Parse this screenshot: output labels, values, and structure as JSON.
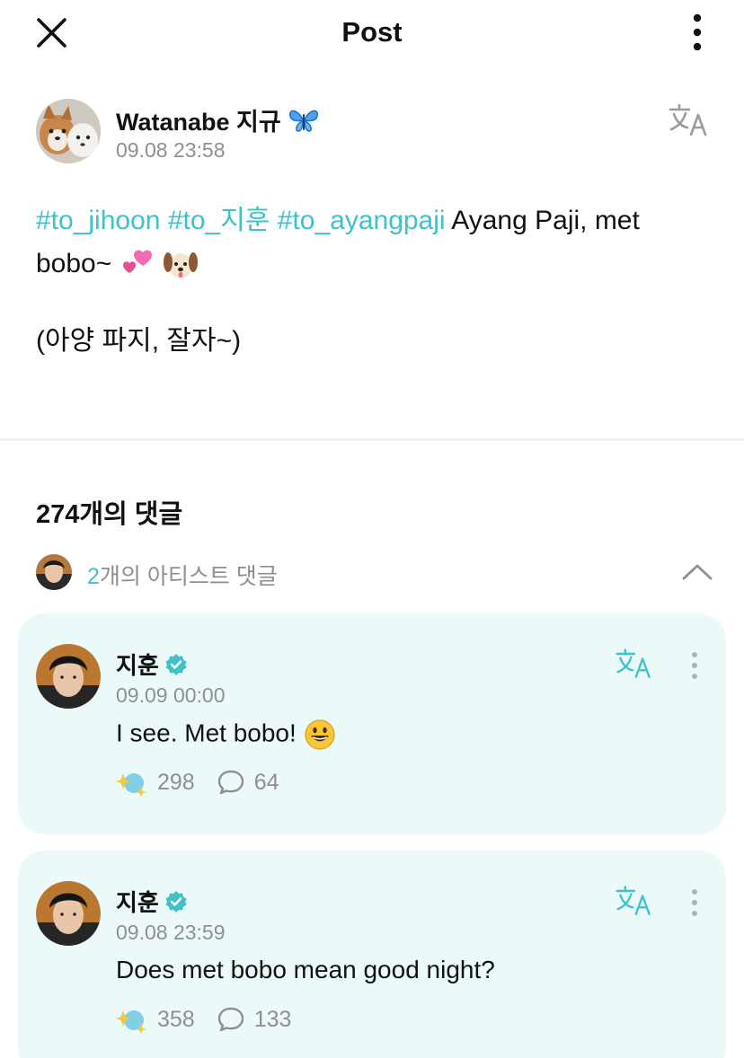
{
  "header": {
    "title": "Post"
  },
  "post": {
    "author_name": "Watanabe 지규",
    "time": "09.08 23:58",
    "hashtags": [
      "#to_jihoon",
      "#to_지훈",
      "#to_ayangpaji"
    ],
    "text_line1": "Ayang Paji, met",
    "text_line2": "bobo~",
    "translation": "(아양 파지, 잘자~)"
  },
  "comments": {
    "count_label": "274개의 댓글",
    "artist_count": "2",
    "artist_label": "개의 아티스트 댓글",
    "items": [
      {
        "author": "지훈",
        "time": "09.09 00:00",
        "text": "I see. Met bobo!",
        "likes": "298",
        "replies": "64"
      },
      {
        "author": "지훈",
        "time": "09.08 23:59",
        "text": "Does met bobo mean good night?",
        "likes": "358",
        "replies": "133"
      }
    ]
  },
  "colors": {
    "accent": "#3fc1c9",
    "card_bg": "#ebfaf8",
    "muted": "#8e8e93"
  },
  "icons": [
    "close-icon",
    "more-vertical-icon",
    "translate-icon",
    "verified-badge-icon",
    "chevron-up-icon",
    "sparkle-react-icon",
    "speech-bubble-icon"
  ]
}
